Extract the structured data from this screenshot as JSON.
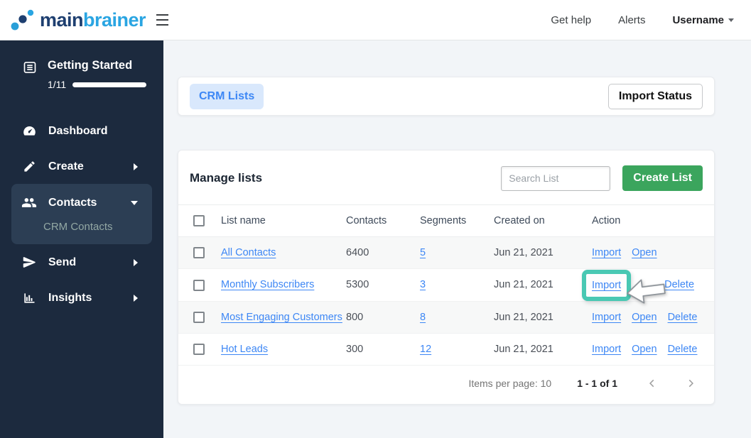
{
  "header": {
    "logo_main": "main",
    "logo_brainer": "brainer",
    "get_help": "Get help",
    "alerts": "Alerts",
    "username": "Username"
  },
  "sidebar": {
    "getting_started": {
      "label": "Getting Started",
      "progress_label": "1/11",
      "progress_pct": 12,
      "icon": "checklist-icon"
    },
    "items": [
      {
        "label": "Dashboard",
        "icon": "gauge-icon",
        "arrow": null,
        "active": false
      },
      {
        "label": "Create",
        "icon": "pencil-icon",
        "arrow": "right",
        "active": false
      },
      {
        "label": "Contacts",
        "icon": "people-icon",
        "arrow": "down",
        "active": true,
        "sub_item": "CRM Contacts"
      },
      {
        "label": "Send",
        "icon": "paper-plane-icon",
        "arrow": "right",
        "active": false
      },
      {
        "label": "Insights",
        "icon": "bar-chart-icon",
        "arrow": "right",
        "active": false
      }
    ]
  },
  "toolbar": {
    "crm_lists_tab": "CRM Lists",
    "import_status_button": "Import Status"
  },
  "manage": {
    "title": "Manage lists",
    "search_placeholder": "Search List",
    "create_button": "Create List"
  },
  "table": {
    "headers": [
      "List name",
      "Contacts",
      "Segments",
      "Created on",
      "Action"
    ],
    "rows": [
      {
        "name": "All Contacts",
        "contacts": "6400",
        "segments": "5",
        "created": "Jun 21, 2021",
        "actions": [
          {
            "label": "Import"
          },
          {
            "label": "Open"
          }
        ]
      },
      {
        "name": "Monthly Subscribers",
        "contacts": "5300",
        "segments": "3",
        "created": "Jun 21, 2021",
        "actions": [
          {
            "label": "Import",
            "highlighted": true
          },
          {
            "label": "Delete"
          }
        ],
        "cursor": true
      },
      {
        "name": "Most Engaging Customers",
        "contacts": "800",
        "segments": "8",
        "created": "Jun 21, 2021",
        "actions": [
          {
            "label": "Import"
          },
          {
            "label": "Open"
          },
          {
            "label": "Delete"
          }
        ]
      },
      {
        "name": "Hot Leads",
        "contacts": "300",
        "segments": "12",
        "created": "Jun 21, 2021",
        "actions": [
          {
            "label": "Import"
          },
          {
            "label": "Open"
          },
          {
            "label": "Delete"
          }
        ]
      }
    ]
  },
  "pagination": {
    "items_per_page": "Items per page: 10",
    "range": "1 - 1 of 1"
  },
  "colors": {
    "accent_blue": "#3d87f5",
    "brand_navy": "#1e3f70",
    "brand_blue": "#2aa5e2",
    "sidebar_bg": "#1c2a3e",
    "sidebar_active_bg": "#2c3e54",
    "green_button": "#3ba55d",
    "progress_green": "#27ae60",
    "teal_highlight": "#49c8b3",
    "crm_chip_bg": "#d9e8fc"
  }
}
